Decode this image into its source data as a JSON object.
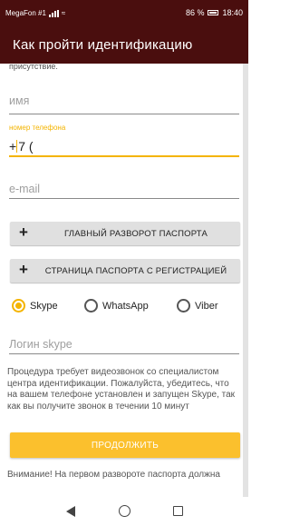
{
  "status_bar": {
    "carrier": "MegaFon #1",
    "battery": "86 %",
    "time": "18:40"
  },
  "app_bar": {
    "title": "Как пройти идентификацию"
  },
  "content": {
    "partial_text": "присутствие.",
    "name_field": {
      "placeholder": "имя"
    },
    "phone_field": {
      "label": "номер телефона",
      "value": "+7 ("
    },
    "email_field": {
      "placeholder": "e-mail"
    },
    "passport_main_button": "ГЛАВНЫЙ РАЗВОРОТ ПАСПОРТА",
    "passport_registration_button": "СТРАНИЦА ПАСПОРТА С РЕГИСТРАЦИЕЙ",
    "messenger_options": [
      {
        "label": "Skype",
        "selected": true
      },
      {
        "label": "WhatsApp",
        "selected": false
      },
      {
        "label": "Viber",
        "selected": false
      }
    ],
    "skype_login_field": {
      "placeholder": "Логин skype"
    },
    "video_call_note": "Процедура требует видеозвонок со специалистом центра идентификации. Пожалуйста, убедитесь, что на вашем телефоне установлен и запущен Skype, так как вы получите звонок в течении 10 минут",
    "continue_button": "ПРОДОЛЖИТЬ",
    "warning_text": "Внимание! На первом развороте паспорта должна"
  },
  "colors": {
    "app_bar": "#4a0e0e",
    "accent": "#f4b400",
    "primary_button": "#fbc02d"
  },
  "icons": {
    "add": "plus-icon",
    "nav_back": "back-triangle-icon",
    "nav_home": "home-circle-icon",
    "nav_recent": "recent-square-icon"
  }
}
